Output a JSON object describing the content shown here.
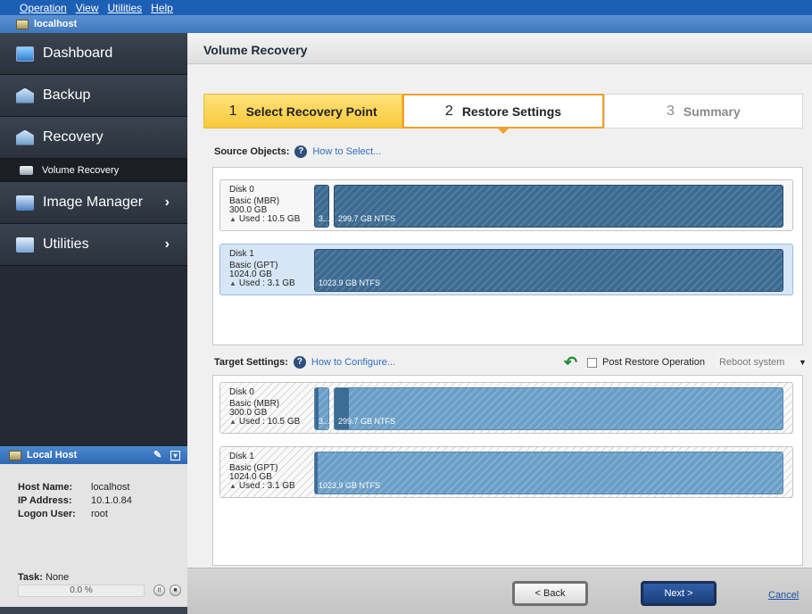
{
  "menubar": {
    "items": [
      "Operation",
      "View",
      "Utilities",
      "Help"
    ]
  },
  "hostbar": {
    "label": "localhost"
  },
  "sidebar": {
    "items": [
      {
        "label": "Dashboard",
        "icon": "dashboard-icon"
      },
      {
        "label": "Backup",
        "icon": "backup-icon"
      },
      {
        "label": "Recovery",
        "icon": "recovery-icon"
      },
      {
        "label": "Volume Recovery",
        "icon": "volume-icon"
      },
      {
        "label": "Image Manager",
        "icon": "image-manager-icon"
      },
      {
        "label": "Utilities",
        "icon": "utilities-icon"
      }
    ]
  },
  "localhost_panel": {
    "title": "Local Host",
    "host_name_label": "Host Name:",
    "host_name": "localhost",
    "ip_label": "IP Address:",
    "ip": "10.1.0.84",
    "logon_label": "Logon User:",
    "logon": "root",
    "task_label": "Task:",
    "task": "None",
    "progress": "0.0 %"
  },
  "main": {
    "title": "Volume Recovery",
    "steps": [
      {
        "num": "1",
        "label": "Select Recovery Point"
      },
      {
        "num": "2",
        "label": "Restore Settings"
      },
      {
        "num": "3",
        "label": "Summary"
      }
    ],
    "source_label": "Source Objects:",
    "source_link": "How to Select...",
    "target_label": "Target Settings:",
    "target_link": "How to Configure...",
    "post_restore_label": "Post Restore Operation",
    "post_restore_option": "Reboot system",
    "source_disks": [
      {
        "name": "Disk 0",
        "type": "Basic (MBR)",
        "size": "300.0 GB",
        "used": "Used : 10.5 GB",
        "small_part": "3...",
        "main_part": "299.7 GB NTFS"
      },
      {
        "name": "Disk 1",
        "type": "Basic (GPT)",
        "size": "1024.0 GB",
        "used": "Used : 3.1 GB",
        "main_part": "1023.9 GB NTFS"
      }
    ],
    "target_disks": [
      {
        "name": "Disk 0",
        "type": "Basic (MBR)",
        "size": "300.0 GB",
        "used": "Used : 10.5 GB",
        "small_part": "3...",
        "main_part": "299.7 GB NTFS"
      },
      {
        "name": "Disk 1",
        "type": "Basic (GPT)",
        "size": "1024.0 GB",
        "used": "Used : 3.1 GB",
        "main_part": "1023.9 GB NTFS"
      }
    ]
  },
  "footer": {
    "back": "< Back",
    "next": "Next >",
    "cancel": "Cancel"
  }
}
